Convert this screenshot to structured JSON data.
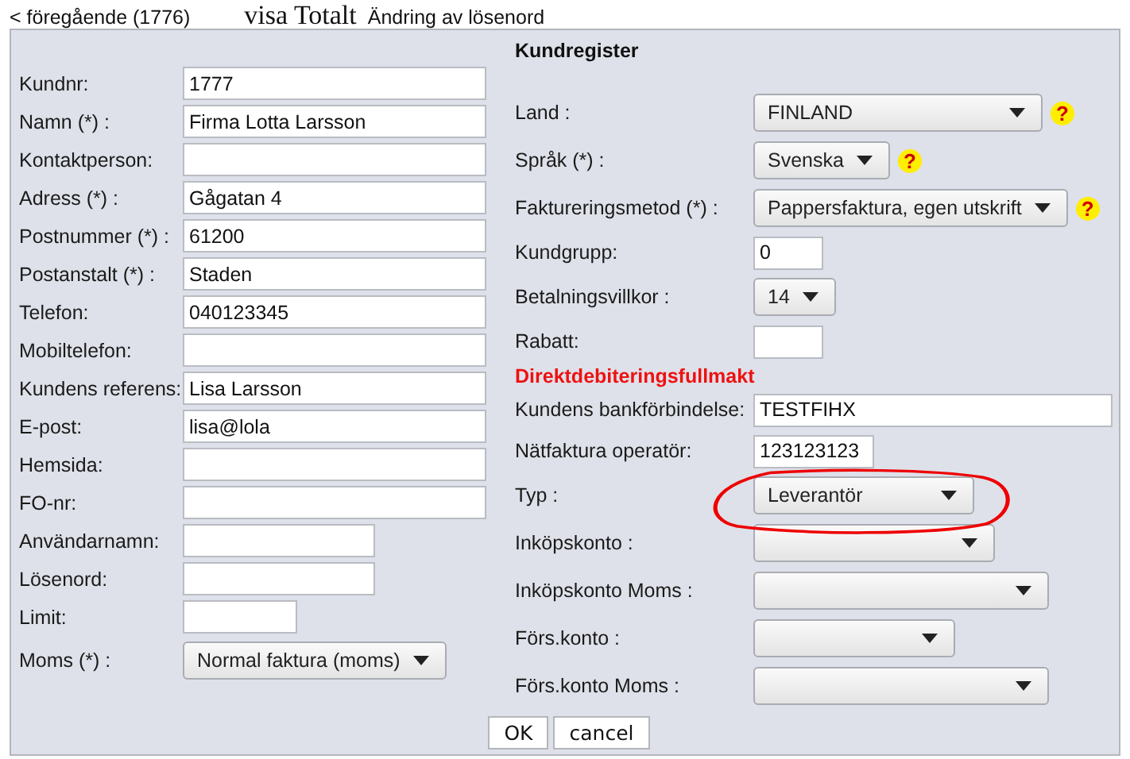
{
  "nav": {
    "previous": "< föregående (1776)",
    "total": "visa Totalt",
    "password": "Ändring av lösenord"
  },
  "title": "Kundregister",
  "left_fields": [
    {
      "kind": "input",
      "label": "Kundnr:",
      "value": "1777"
    },
    {
      "kind": "input",
      "label": "Namn (*) :",
      "value": "Firma Lotta Larsson"
    },
    {
      "kind": "input",
      "label": "Kontaktperson:"
    },
    {
      "kind": "input",
      "label": "Adress (*) :",
      "value": "Gågatan 4"
    },
    {
      "kind": "input",
      "label": "Postnummer (*) :",
      "value": "61200"
    },
    {
      "kind": "input",
      "label": "Postanstalt (*) :",
      "value": "Staden"
    },
    {
      "kind": "input",
      "label": "Telefon:",
      "value": "040123345"
    },
    {
      "kind": "input",
      "label": "Mobiltelefon:"
    },
    {
      "kind": "input",
      "label": "Kundens referens:",
      "value": "Lisa Larsson"
    },
    {
      "kind": "input",
      "label": "E-post:",
      "value": "lisa@lola"
    },
    {
      "kind": "input",
      "label": "Hemsida:"
    },
    {
      "kind": "input",
      "label": "FO-nr:"
    },
    {
      "kind": "input",
      "label": "Användarnamn:"
    },
    {
      "kind": "input",
      "label": "Lösenord:"
    },
    {
      "kind": "input",
      "label": "Limit:"
    },
    {
      "kind": "select",
      "label": "Moms (*) :",
      "value": "Normal faktura (moms)"
    }
  ],
  "right_fields": [
    {
      "kind": "select",
      "label": "Land :",
      "value": "FINLAND",
      "help": "?"
    },
    {
      "kind": "select",
      "label": "Språk (*) :",
      "value": "Svenska",
      "help": "?"
    },
    {
      "kind": "select",
      "label": "Faktureringsmetod (*) :",
      "value": "Pappersfaktura, egen utskrift",
      "help": "?"
    },
    {
      "kind": "input",
      "label": "Kundgrupp:",
      "value": "0"
    },
    {
      "kind": "select",
      "label": "Betalningsvillkor :",
      "value": "14"
    },
    {
      "kind": "input",
      "label": "Rabatt:"
    },
    {
      "kind": "heading",
      "label": "Direktdebiteringsfullmakt"
    },
    {
      "kind": "input",
      "label": "Kundens bankförbindelse:",
      "value": "TESTFIHX"
    },
    {
      "kind": "input",
      "label": "Nätfaktura operatör:",
      "value": "123123123"
    },
    {
      "kind": "select",
      "label": "Typ :",
      "value": "Leverantör",
      "circled": true
    },
    {
      "kind": "select",
      "label": "Inköpskonto :"
    },
    {
      "kind": "select",
      "label": "Inköpskonto Moms :"
    },
    {
      "kind": "select",
      "label": "Förs.konto :"
    },
    {
      "kind": "select",
      "label": "Förs.konto Moms :"
    }
  ],
  "buttons": [
    "OK",
    "cancel"
  ]
}
